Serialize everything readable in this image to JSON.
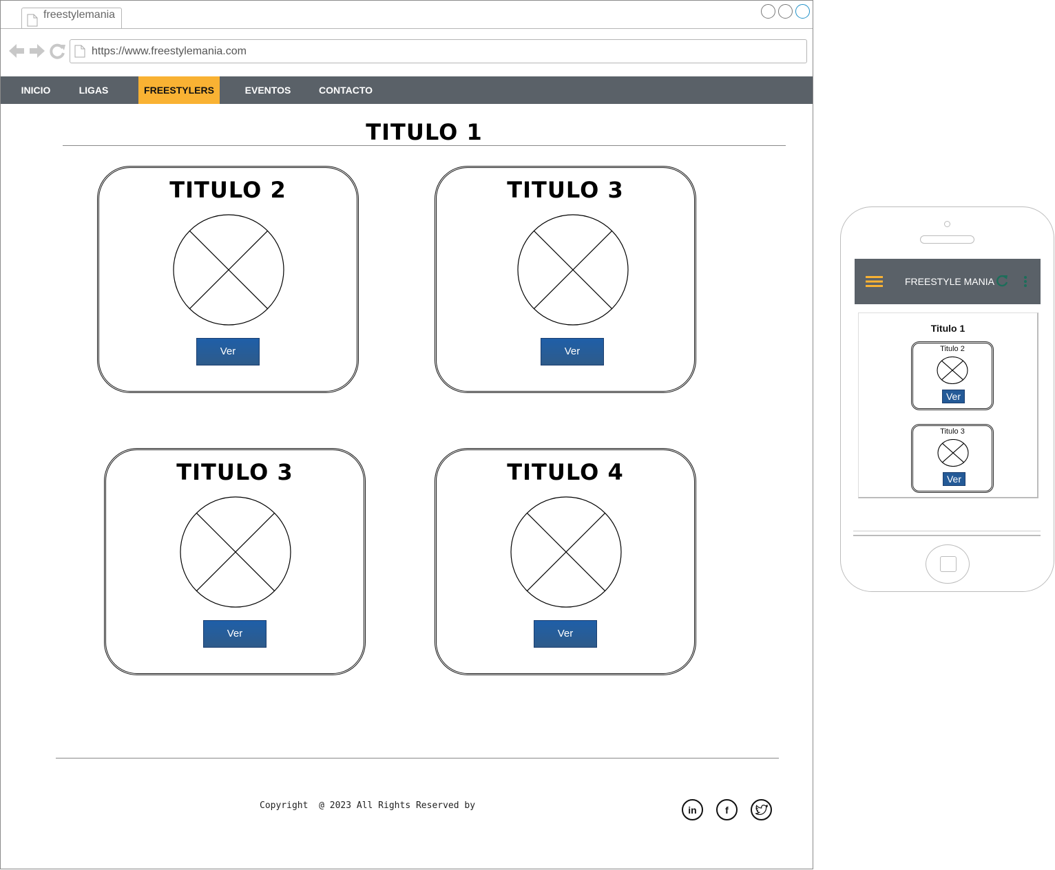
{
  "browser": {
    "tab_title": "freestylemania",
    "url": "https://www.freestylemania.com"
  },
  "nav": {
    "items": [
      {
        "label": "INICIO",
        "active": false
      },
      {
        "label": "LIGAS",
        "active": false
      },
      {
        "label": "FREESTYLERS",
        "active": true
      },
      {
        "label": "EVENTOS",
        "active": false
      },
      {
        "label": "CONTACTO",
        "active": false
      }
    ],
    "active_color": "#f9b233",
    "bar_color": "#5a6168"
  },
  "main": {
    "title": "TITULO 1",
    "cards": [
      {
        "title": "TITULO 2",
        "button": "Ver"
      },
      {
        "title": "TITULO 3",
        "button": "Ver"
      },
      {
        "title": "TITULO 3",
        "button": "Ver"
      },
      {
        "title": "TITULO 4",
        "button": "Ver"
      }
    ]
  },
  "footer": {
    "copyright": "Copyright  @ 2023 All Rights Reserved by",
    "social": [
      {
        "icon": "linkedin-icon",
        "glyph": "in"
      },
      {
        "icon": "facebook-icon",
        "glyph": "f"
      },
      {
        "icon": "twitter-icon",
        "glyph": "t"
      }
    ]
  },
  "mobile": {
    "app_title": "FREESTYLE MANIA",
    "page_title": "Titulo 1",
    "cards": [
      {
        "title": "Titulo 2",
        "button": "Ver"
      },
      {
        "title": "Titulo 3",
        "button": "Ver"
      }
    ],
    "menu_icon_color": "#f9b233",
    "refresh_icon_color": "#1c6e5a"
  }
}
